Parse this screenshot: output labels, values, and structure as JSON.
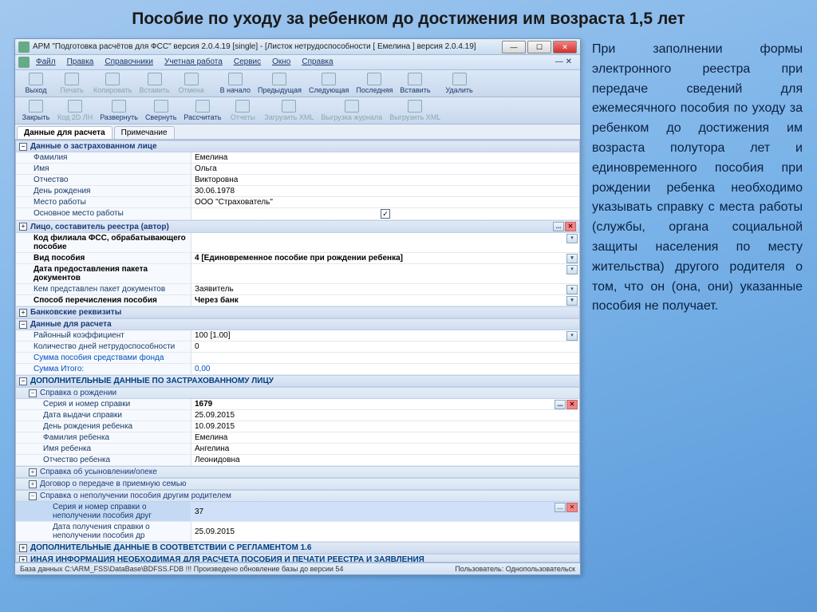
{
  "slide_title": "Пособие по уходу за ребенком до достижения им возраста 1,5 лет",
  "window_title": "АРМ \"Подготовка расчётов для ФСС\"  версия 2.0.4.19 [single] - [Листок нетрудоспособности [ Емелина ]  версия 2.0.4.19]",
  "menu": {
    "file": "Файл",
    "edit": "Правка",
    "ref": "Справочники",
    "acc": "Учетная работа",
    "service": "Сервис",
    "window": "Окно",
    "help": "Справка"
  },
  "toolbar1": {
    "exit": "Выход",
    "print": "Печать",
    "copy": "Копировать",
    "paste": "Вставить",
    "cancel": "Отмена",
    "sep": "",
    "first": "В начало",
    "prev": "Предыдущая",
    "next": "Следующая",
    "last": "Последняя",
    "insert": "Вставить",
    "delete": "Удалить"
  },
  "toolbar2": {
    "close": "Закрыть",
    "code2d": "Код 2D ЛН",
    "expand": "Развернуть",
    "collapse": "Свернуть",
    "calc": "Рассчитать",
    "reports": "Отчеты",
    "loadxml": "Загрузить XML",
    "journal": "Выгрузка журнала",
    "exportxml": "Выгрузить XML"
  },
  "tabs": {
    "data": "Данные для расчета",
    "note": "Примечание"
  },
  "sections": {
    "insured": "Данные о застрахованном лице",
    "author": "Лицо, составитель реестра (автор)",
    "bank": "Банковские реквизиты",
    "calc": "Данные для расчета",
    "extra_insured": "ДОПОЛНИТЕЛЬНЫЕ ДАННЫЕ ПО ЗАСТРАХОВАННОМУ ЛИЦУ",
    "birth_cert": "Справка о рождении",
    "adopt": "Справка об усыновлении/опеке",
    "foster": "Договор о передаче в приемную семью",
    "other_parent": "Справка о неполучении пособия другим родителем",
    "reg16": "ДОПОЛНИТЕЛЬНЫЕ ДАННЫЕ В СООТВЕТСТВИИ С РЕГЛАМЕНТОМ 1.6",
    "other_info": "ИНАЯ ИНФОРМАЦИЯ НЕОБХОДИМАЯ ДЛЯ РАСЧЕТА ПОСОБИЯ И ПЕЧАТИ РЕЕСТРА И ЗАЯВЛЕНИЯ"
  },
  "fields": {
    "surname_l": "Фамилия",
    "surname_v": "Емелина",
    "name_l": "Имя",
    "name_v": "Ольга",
    "patr_l": "Отчество",
    "patr_v": "Викторовна",
    "bday_l": "День рождения",
    "bday_v": "30.06.1978",
    "work_l": "Место работы",
    "work_v": "ООО \"Страхователь\"",
    "main_l": "Основное место работы",
    "fss_code_l": "Код филиала ФСС, обрабатывающего пособие",
    "benefit_type_l": "Вид пособия",
    "benefit_type_v": "4 [Единовременное пособие при рождении ребенка]",
    "docs_date_l": "Дата предоставления пакета документов",
    "docs_by_l": "Кем представлен пакет документов",
    "docs_by_v": "Заявитель",
    "pay_method_l": "Способ перечисления пособия",
    "pay_method_v": "Через банк",
    "coef_l": "Районный коэффициент",
    "coef_v": "100 [1.00]",
    "days_l": "Количество дней нетрудоспособности",
    "days_v": "0",
    "sum_fund_l": "Сумма пособия средствами фонда",
    "sum_total_l": "Сумма Итого:",
    "sum_total_v": "0,00",
    "cert_num_l": "Серия и номер справки",
    "cert_num_v": "1679",
    "cert_date_l": "Дата выдачи справки",
    "cert_date_v": "25.09.2015",
    "child_bday_l": "День рождения ребенка",
    "child_bday_v": "10.09.2015",
    "child_surname_l": "Фамилия ребенка",
    "child_surname_v": "Емелина",
    "child_name_l": "Имя ребенка",
    "child_name_v": "Ангелина",
    "child_patr_l": "Отчество ребенка",
    "child_patr_v": "Леонидовна",
    "op_cert_l": "Серия и номер справки о неполучении пособия друг",
    "op_cert_v": "37",
    "op_date_l": "Дата получения справки о неполучении пособия др",
    "op_date_v": "25.09.2015"
  },
  "status": {
    "db": "База данных  C:\\ARM_FSS\\DataBase\\BDFSS.FDB   !!! Произведено обновление базы до версии 54",
    "user": "Пользователь: Однопользовательск"
  },
  "side_text": "При заполнении формы электронного реестра при передаче сведений для ежемесячного пособия по уходу за ребенком до достижения им возраста полутора лет и единовременного пособия при рождении ребенка необходимо указывать справку с места работы (службы, органа социальной защиты населения по месту жительства) другого родителя о том, что он (она, они) указанные пособия не получает."
}
